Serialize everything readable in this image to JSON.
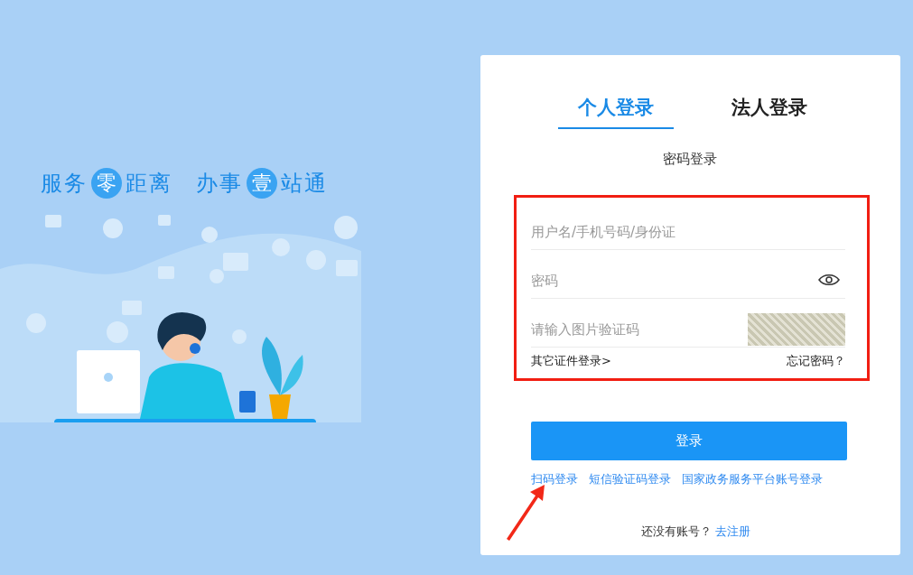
{
  "slogan": [
    {
      "parts": [
        {
          "kind": "text",
          "text": "服务"
        },
        {
          "kind": "circle",
          "text": "零"
        },
        {
          "kind": "text",
          "text": "距离"
        }
      ]
    },
    {
      "parts": [
        {
          "kind": "text",
          "text": "办事"
        },
        {
          "kind": "circle",
          "text": "壹"
        },
        {
          "kind": "text",
          "text": "站通"
        }
      ]
    }
  ],
  "tabs": [
    {
      "label": "个人登录",
      "selected": true
    },
    {
      "label": "法人登录",
      "selected": false
    }
  ],
  "subtitle": "密码登录",
  "fields": [
    {
      "kind": "text",
      "placeholder": "用户名/手机号码/身份证"
    },
    {
      "kind": "password",
      "placeholder": "密码"
    },
    {
      "kind": "captcha",
      "placeholder": "请输入图片验证码"
    }
  ],
  "other_id_link": "其它证件登录>",
  "forgot_link": "忘记密码？",
  "login_button": "登录",
  "alt_logins": [
    "扫码登录",
    "短信验证码登录",
    "国家政务服务平台账号登录"
  ],
  "register": {
    "prompt": "还没有账号？",
    "link": "去注册"
  }
}
